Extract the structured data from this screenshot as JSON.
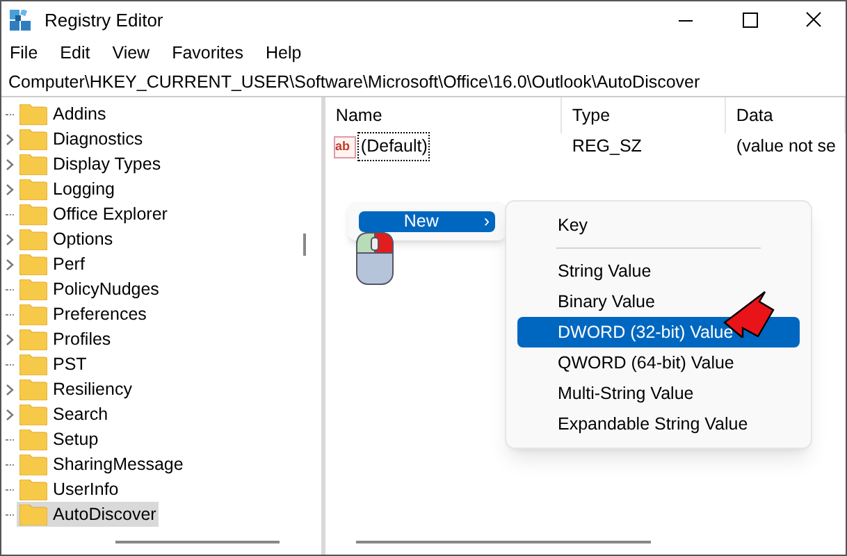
{
  "window": {
    "title": "Registry Editor"
  },
  "menu_bar": [
    "File",
    "Edit",
    "View",
    "Favorites",
    "Help"
  ],
  "address_bar": "Computer\\HKEY_CURRENT_USER\\Software\\Microsoft\\Office\\16.0\\Outlook\\AutoDiscover",
  "tree": [
    {
      "label": "Addins",
      "expandable": false,
      "selected": false
    },
    {
      "label": "Diagnostics",
      "expandable": true,
      "selected": false
    },
    {
      "label": "Display Types",
      "expandable": true,
      "selected": false
    },
    {
      "label": "Logging",
      "expandable": true,
      "selected": false
    },
    {
      "label": "Office Explorer",
      "expandable": false,
      "selected": false
    },
    {
      "label": "Options",
      "expandable": true,
      "selected": false
    },
    {
      "label": "Perf",
      "expandable": true,
      "selected": false
    },
    {
      "label": "PolicyNudges",
      "expandable": false,
      "selected": false
    },
    {
      "label": "Preferences",
      "expandable": false,
      "selected": false
    },
    {
      "label": "Profiles",
      "expandable": true,
      "selected": false
    },
    {
      "label": "PST",
      "expandable": false,
      "selected": false
    },
    {
      "label": "Resiliency",
      "expandable": true,
      "selected": false
    },
    {
      "label": "Search",
      "expandable": true,
      "selected": false
    },
    {
      "label": "Setup",
      "expandable": false,
      "selected": false
    },
    {
      "label": "SharingMessage",
      "expandable": false,
      "selected": false
    },
    {
      "label": "UserInfo",
      "expandable": false,
      "selected": false
    },
    {
      "label": "AutoDiscover",
      "expandable": false,
      "selected": true
    }
  ],
  "table": {
    "columns": [
      "Name",
      "Type",
      "Data"
    ],
    "rows": [
      {
        "icon_text": "ab",
        "name": "(Default)",
        "type": "REG_SZ",
        "data": "(value not se"
      }
    ]
  },
  "context_menu": {
    "item": "New",
    "arrow": "›",
    "selected": true
  },
  "submenu": [
    {
      "kind": "item",
      "label": "Key",
      "selected": false
    },
    {
      "kind": "separator"
    },
    {
      "kind": "item",
      "label": "String Value",
      "selected": false
    },
    {
      "kind": "item",
      "label": "Binary Value",
      "selected": false
    },
    {
      "kind": "item",
      "label": "DWORD (32-bit) Value",
      "selected": true
    },
    {
      "kind": "item",
      "label": "QWORD (64-bit) Value",
      "selected": false
    },
    {
      "kind": "item",
      "label": "Multi-String Value",
      "selected": false
    },
    {
      "kind": "item",
      "label": "Expandable String Value",
      "selected": false
    }
  ]
}
